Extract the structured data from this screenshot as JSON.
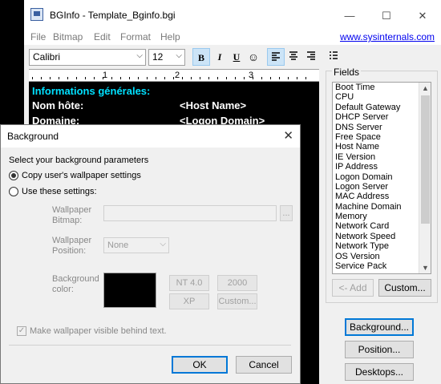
{
  "window": {
    "title": "BGInfo - Template_Bginfo.bgi",
    "minimize_glyph": "—",
    "maximize_glyph": "☐",
    "close_glyph": "✕"
  },
  "menu": {
    "items": [
      "File",
      "Bitmap",
      "Edit",
      "Format",
      "Help"
    ],
    "link": "www.sysinternals.com"
  },
  "toolbar": {
    "font": "Calibri",
    "size": "12",
    "bold": "B",
    "italic": "I",
    "underline": "U"
  },
  "ruler": [
    "1",
    "2",
    "3"
  ],
  "editor": {
    "lines": [
      {
        "left": "Informations générales:",
        "right": ""
      },
      {
        "left": "Nom hôte:",
        "right": "<Host Name>"
      },
      {
        "left": "Domaine:",
        "right": "<Logon Domain>"
      }
    ]
  },
  "fields": {
    "label": "Fields",
    "items": [
      "Boot Time",
      "CPU",
      "Default Gateway",
      "DHCP Server",
      "DNS Server",
      "Free Space",
      "Host Name",
      "IE Version",
      "IP Address",
      "Logon Domain",
      "Logon Server",
      "MAC Address",
      "Machine Domain",
      "Memory",
      "Network Card",
      "Network Speed",
      "Network Type",
      "OS Version",
      "Service Pack"
    ],
    "add_button": "<- Add",
    "custom_button": "Custom..."
  },
  "side_buttons": {
    "background": "Background...",
    "position": "Position...",
    "desktops": "Desktops..."
  },
  "dialog": {
    "title": "Background",
    "instruction": "Select your background parameters",
    "option_copy": "Copy user's wallpaper settings",
    "option_use": "Use these settings:",
    "wallpaper_bitmap_label": "Wallpaper Bitmap:",
    "browse": "...",
    "wallpaper_position_label": "Wallpaper Position:",
    "position_value": "None",
    "background_color_label": "Background color:",
    "color_buttons": [
      "NT 4.0",
      "2000",
      "XP",
      "Custom..."
    ],
    "visible_checkbox": "Make wallpaper visible behind text.",
    "ok": "OK",
    "cancel": "Cancel",
    "background_color": "#000000"
  }
}
